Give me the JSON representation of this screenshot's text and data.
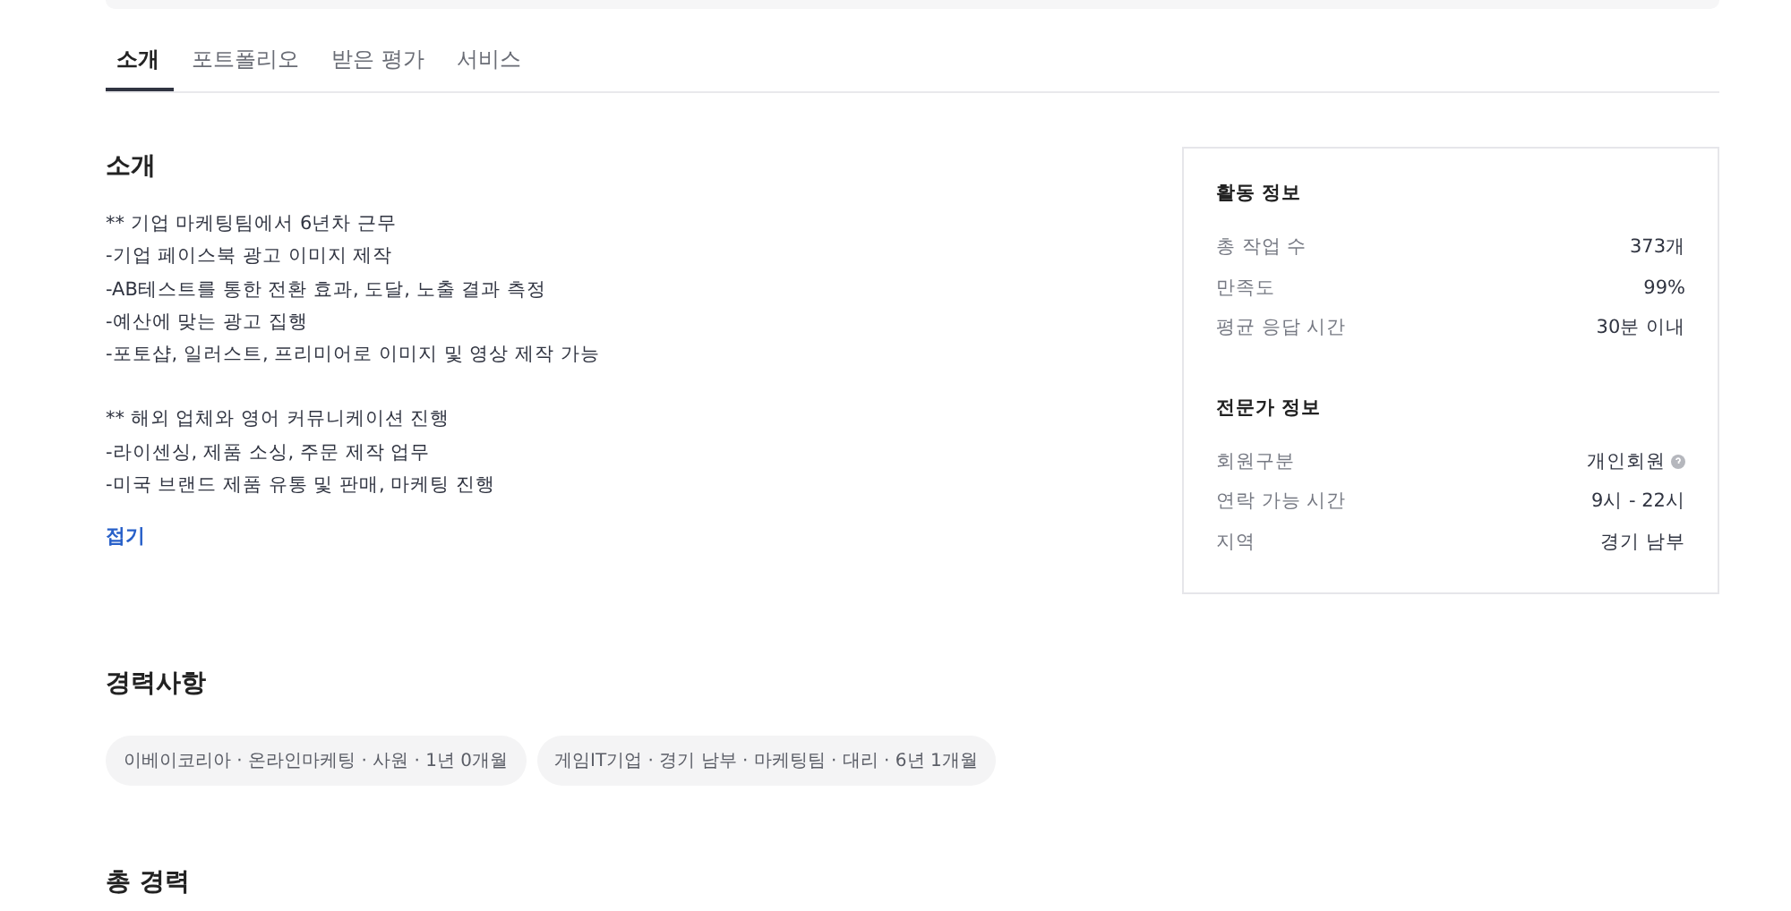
{
  "tabs": [
    {
      "label": "소개",
      "selected": true
    },
    {
      "label": "포트폴리오",
      "selected": false
    },
    {
      "label": "받은 평가",
      "selected": false
    },
    {
      "label": "서비스",
      "selected": false
    }
  ],
  "intro": {
    "title": "소개",
    "paragraphs": [
      [
        "** 기업 마케팅팀에서 6년차 근무",
        "-기업 페이스북 광고 이미지 제작",
        "-AB테스트를 통한 전환 효과, 도달, 노출 결과 측정",
        "-예산에 맞는 광고 집행",
        "-포토샵, 일러스트, 프리미어로 이미지 및 영상 제작 가능"
      ],
      [
        "** 해외 업체와 영어 커뮤니케이션 진행",
        "-라이센싱, 제품 소싱, 주문 제작 업무",
        "-미국 브랜드 제품 유통 및 판매, 마케팅 진행"
      ]
    ],
    "toggle": "접기"
  },
  "career": {
    "title": "경력사항",
    "items": [
      "이베이코리아 · 온라인마케팅 · 사원 · 1년 0개월",
      "게임IT기업 · 경기 남부 · 마케팅팀 · 대리 · 6년 1개월"
    ]
  },
  "total_career": {
    "title": "총 경력"
  },
  "info_card": {
    "sections": [
      {
        "title": "활동 정보",
        "rows": [
          {
            "label": "총 작업 수",
            "value": "373개",
            "help": false
          },
          {
            "label": "만족도",
            "value": "99%",
            "help": false
          },
          {
            "label": "평균 응답 시간",
            "value": "30분 이내",
            "help": false
          }
        ]
      },
      {
        "title": "전문가 정보",
        "rows": [
          {
            "label": "회원구분",
            "value": "개인회원",
            "help": true
          },
          {
            "label": "연락 가능 시간",
            "value": "9시 - 22시",
            "help": false
          },
          {
            "label": "지역",
            "value": "경기 남부",
            "help": false
          }
        ]
      }
    ]
  }
}
